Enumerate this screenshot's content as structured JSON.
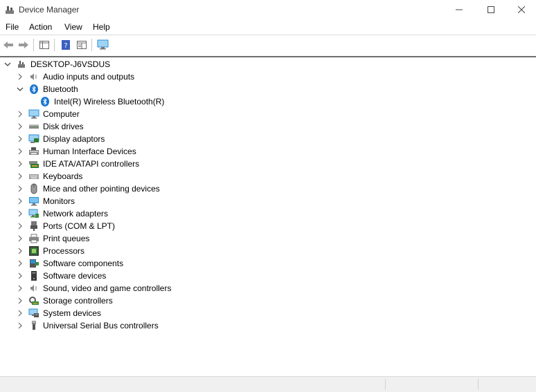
{
  "window": {
    "title": "Device Manager"
  },
  "menu": [
    "File",
    "Action",
    "View",
    "Help"
  ],
  "tree": {
    "root": "DESKTOP-J6VSDUS",
    "items": [
      {
        "label": "Audio inputs and outputs",
        "icon": "speaker-icon",
        "expanded": false
      },
      {
        "label": "Bluetooth",
        "icon": "bluetooth-icon",
        "expanded": true,
        "children": [
          {
            "label": "Intel(R) Wireless Bluetooth(R)",
            "icon": "bluetooth-icon"
          }
        ]
      },
      {
        "label": "Computer",
        "icon": "computer-icon",
        "expanded": false
      },
      {
        "label": "Disk drives",
        "icon": "disk-drive-icon",
        "expanded": false
      },
      {
        "label": "Display adaptors",
        "icon": "display-adapter-icon",
        "expanded": false
      },
      {
        "label": "Human Interface Devices",
        "icon": "hid-icon",
        "expanded": false
      },
      {
        "label": "IDE ATA/ATAPI controllers",
        "icon": "ide-controller-icon",
        "expanded": false
      },
      {
        "label": "Keyboards",
        "icon": "keyboard-icon",
        "expanded": false
      },
      {
        "label": "Mice and other pointing devices",
        "icon": "mouse-icon",
        "expanded": false
      },
      {
        "label": "Monitors",
        "icon": "monitor-icon",
        "expanded": false
      },
      {
        "label": "Network adapters",
        "icon": "network-adapter-icon",
        "expanded": false
      },
      {
        "label": "Ports (COM & LPT)",
        "icon": "port-icon",
        "expanded": false
      },
      {
        "label": "Print queues",
        "icon": "printer-icon",
        "expanded": false
      },
      {
        "label": "Processors",
        "icon": "processor-icon",
        "expanded": false
      },
      {
        "label": "Software components",
        "icon": "software-component-icon",
        "expanded": false
      },
      {
        "label": "Software devices",
        "icon": "software-device-icon",
        "expanded": false
      },
      {
        "label": "Sound, video and game controllers",
        "icon": "speaker-icon",
        "expanded": false
      },
      {
        "label": "Storage controllers",
        "icon": "storage-controller-icon",
        "expanded": false
      },
      {
        "label": "System devices",
        "icon": "system-device-icon",
        "expanded": false
      },
      {
        "label": "Universal Serial Bus controllers",
        "icon": "usb-icon",
        "expanded": false
      }
    ]
  },
  "colors": {
    "bluetooth": "#1976d2",
    "monitor": "#2f8fd8",
    "toolbar_help": "#3b5fc0"
  }
}
